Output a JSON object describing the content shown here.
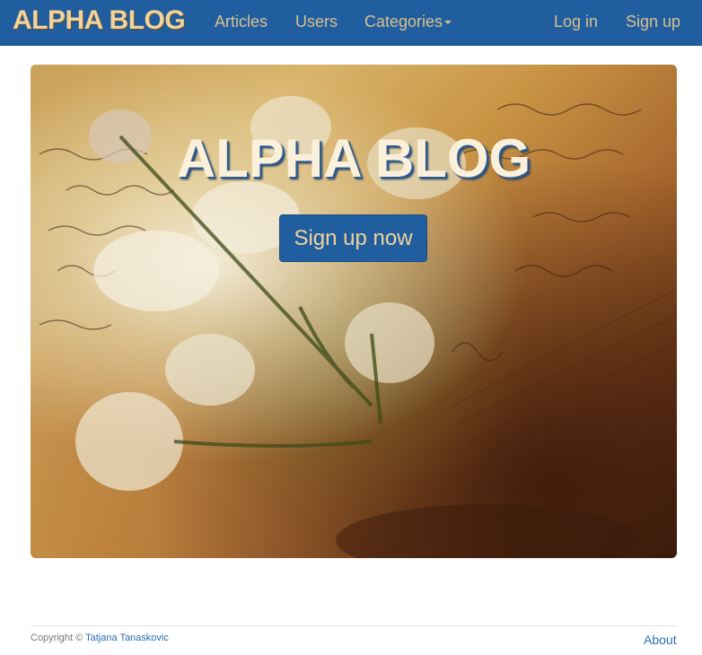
{
  "nav": {
    "brand": "ALPHA BLOG",
    "links": {
      "articles": "Articles",
      "users": "Users",
      "categories": "Categories",
      "login": "Log in",
      "signup": "Sign up"
    }
  },
  "hero": {
    "title": "ALPHA BLOG",
    "button": "Sign up now"
  },
  "footer": {
    "copyright_prefix": "Copyright ©",
    "author": "Tatjana Tanaskovic",
    "about": "About"
  },
  "colors": {
    "navbar": "#215e9f",
    "brand_text": "#f2d49a",
    "link": "#2a6fb5"
  }
}
